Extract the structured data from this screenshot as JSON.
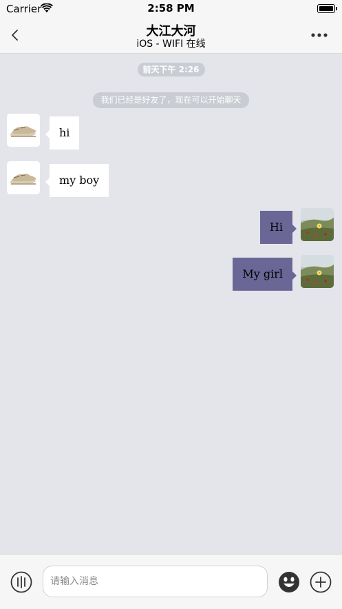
{
  "status_bar": {
    "carrier": "Carrier",
    "time": "2:58 PM"
  },
  "nav": {
    "title": "大江大河",
    "subtitle": "iOS - WIFI 在线"
  },
  "chat": {
    "timestamp": "前天下午 2:26",
    "system_notice": "我们已经是好友了，现在可以开始聊天",
    "messages": [
      {
        "side": "left",
        "text": "hi"
      },
      {
        "side": "left",
        "text": "my boy"
      },
      {
        "side": "right",
        "text": "Hi"
      },
      {
        "side": "right",
        "text": "My girl"
      }
    ]
  },
  "input": {
    "placeholder": "请输入消息"
  },
  "colors": {
    "background": "#e3e5ea",
    "outgoing_bubble": "#6a6797",
    "incoming_bubble": "#ffffff"
  },
  "icons": [
    "back-chevron-icon",
    "more-icon",
    "voice-icon",
    "emoji-icon",
    "plus-icon",
    "wifi-icon",
    "battery-icon"
  ]
}
